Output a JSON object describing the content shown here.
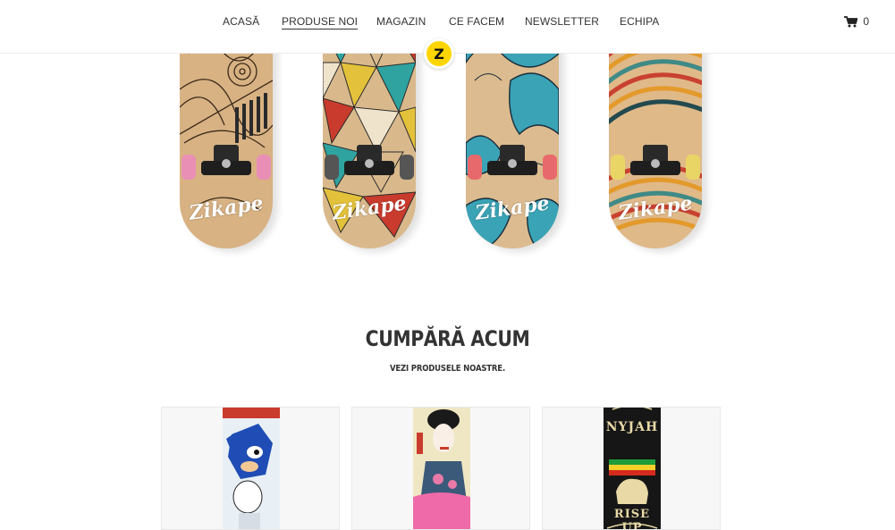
{
  "nav": {
    "items": [
      {
        "label": "ACASĂ",
        "active": false
      },
      {
        "label": "PRODUSE NOI",
        "active": true
      },
      {
        "label": "MAGAZIN",
        "active": false
      },
      {
        "label": "CE FACEM",
        "active": false
      },
      {
        "label": "NEWSLETTER",
        "active": false
      },
      {
        "label": "ECHIPA",
        "active": false
      }
    ],
    "cart_count": "0"
  },
  "logo": {
    "letter": "Z"
  },
  "hero": {
    "boards": [
      {
        "brand": "Zikape",
        "deck_color": "#d8b283",
        "wheel_color": "#e98fb5"
      },
      {
        "brand": "Zikape",
        "deck_color": "#d9b98c",
        "wheel_color": "#555555"
      },
      {
        "brand": "Zikape",
        "deck_color": "#dbbb8f",
        "wheel_color": "#e8696b"
      },
      {
        "brand": "Zikape",
        "deck_color": "#e0b989",
        "wheel_color": "#e9d566"
      }
    ]
  },
  "section": {
    "title": "CUMPĂRĂ ACUM",
    "subtitle": "VEZI PRODUSELE NOASTRE."
  },
  "products": [
    {
      "image": "sonic-deck",
      "deck_text": ""
    },
    {
      "image": "geisha-deck",
      "deck_text": ""
    },
    {
      "image": "lion-deck",
      "deck_text_top": "NYJAH",
      "deck_text_bottom": "RISE UP"
    }
  ],
  "colors": {
    "accent_yellow": "#ffd500",
    "text": "#333333",
    "border": "#ececec"
  }
}
